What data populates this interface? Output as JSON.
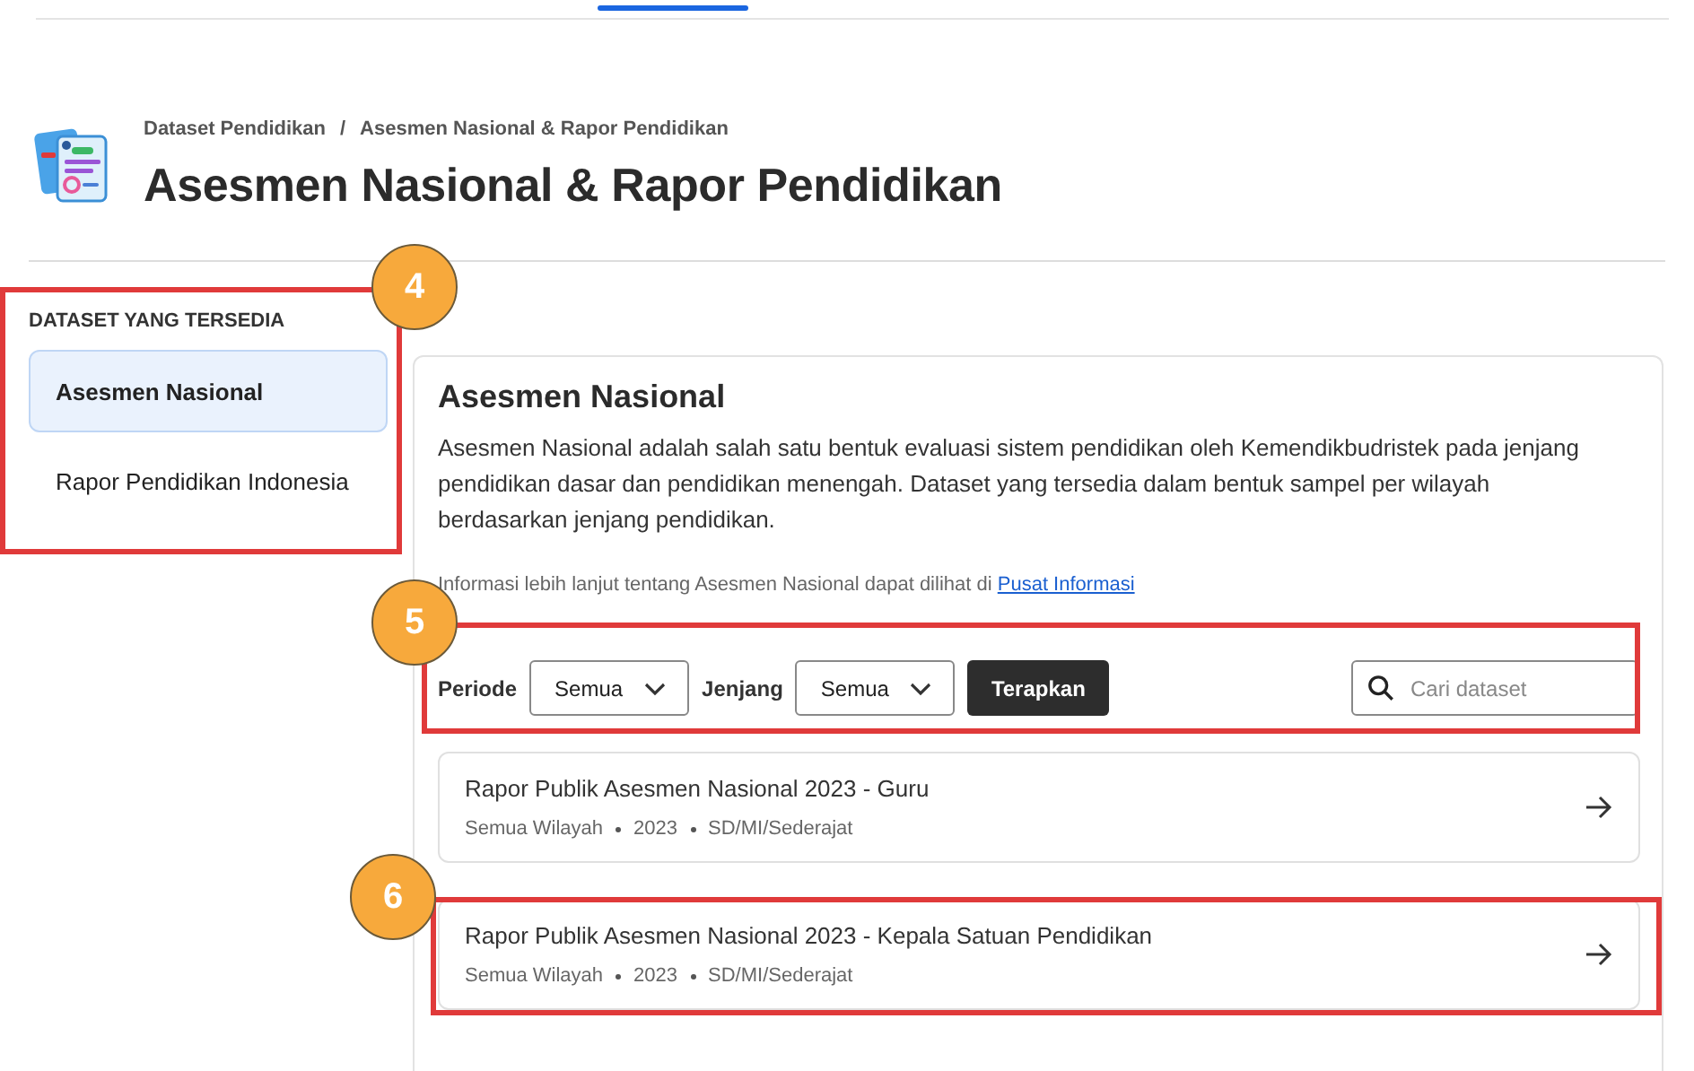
{
  "header": {
    "breadcrumb": [
      "Dataset Pendidikan",
      "Asesmen Nasional & Rapor Pendidikan"
    ],
    "breadcrumb_separator": "/",
    "title": "Asesmen Nasional & Rapor Pendidikan"
  },
  "sidebar": {
    "heading": "DATASET YANG TERSEDIA",
    "callout": "4",
    "items": [
      {
        "label": "Asesmen Nasional",
        "selected": true
      },
      {
        "label": "Rapor Pendidikan Indonesia",
        "selected": false
      }
    ]
  },
  "content": {
    "title": "Asesmen Nasional",
    "description": "Asesmen Nasional adalah salah satu bentuk evaluasi sistem pendidikan oleh Kemendikbudristek pada jenjang pendidikan dasar dan pendidikan menengah. Dataset yang tersedia dalam bentuk sampel per wilayah berdasarkan jenjang pendidikan.",
    "info_text": "Informasi lebih lanjut tentang Asesmen Nasional dapat dilihat di",
    "info_link": "Pusat Informasi",
    "filters": {
      "callout": "5",
      "selects": [
        {
          "label": "Periode",
          "value": "Semua"
        },
        {
          "label": "Jenjang",
          "value": "Semua"
        }
      ],
      "apply_button": "Terapkan",
      "search": {
        "placeholder": "Cari dataset"
      }
    },
    "datasets": [
      {
        "title": "Rapor Publik Asesmen Nasional 2023 - Guru",
        "meta": [
          "Semua Wilayah",
          "2023",
          "SD/MI/Sederajat"
        ]
      },
      {
        "title": "Rapor Publik Asesmen Nasional 2023 - Kepala Satuan Pendidikan",
        "meta": [
          "Semua Wilayah",
          "2023",
          "SD/MI/Sederajat"
        ],
        "callout": "6"
      }
    ]
  }
}
